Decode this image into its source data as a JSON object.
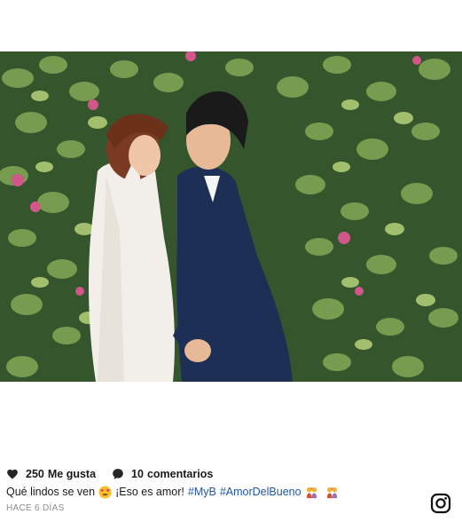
{
  "post": {
    "image": {
      "alt": "Pareja besándose frente a una pared de hojas verdes con flores rosas"
    },
    "likes": {
      "count": "250",
      "label": "Me gusta",
      "icon": "heart-icon"
    },
    "comments": {
      "count": "10",
      "label": "comentarios",
      "icon": "comment-bubble-icon"
    },
    "caption": {
      "text_before": "Qué lindos se ven",
      "text_middle": "¡Eso es amor!",
      "emoji_1": "heart-eyes-emoji",
      "hashtags": [
        "#MyB",
        "#AmorDelBueno"
      ],
      "emoji_trailing": [
        "couple-kiss-emoji",
        "couple-kiss-emoji"
      ]
    },
    "timestamp": "HACE 6 DÍAS",
    "brand_icon": "instagram-logo-icon"
  },
  "colors": {
    "hashtag": "#1f57a8",
    "timestamp": "#8e8e8e",
    "text": "#1a1a1a"
  }
}
